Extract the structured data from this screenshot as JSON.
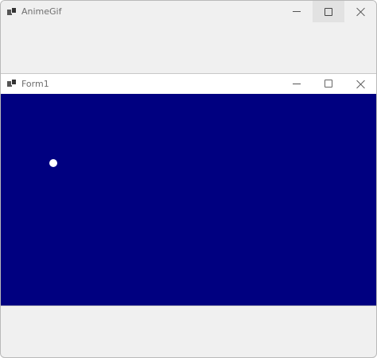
{
  "outer_window": {
    "title": "AnimeGif",
    "icon": "app-window-icon",
    "buttons": [
      "minimize",
      "maximize",
      "close"
    ]
  },
  "inner_window": {
    "title": "Form1",
    "icon": "app-window-icon",
    "buttons": [
      "minimize",
      "maximize",
      "close"
    ],
    "client_color": "#000080",
    "ball_color": "#ffffff"
  },
  "colors": {
    "frame_background": "#f0f0f0",
    "client_background": "#000080"
  }
}
